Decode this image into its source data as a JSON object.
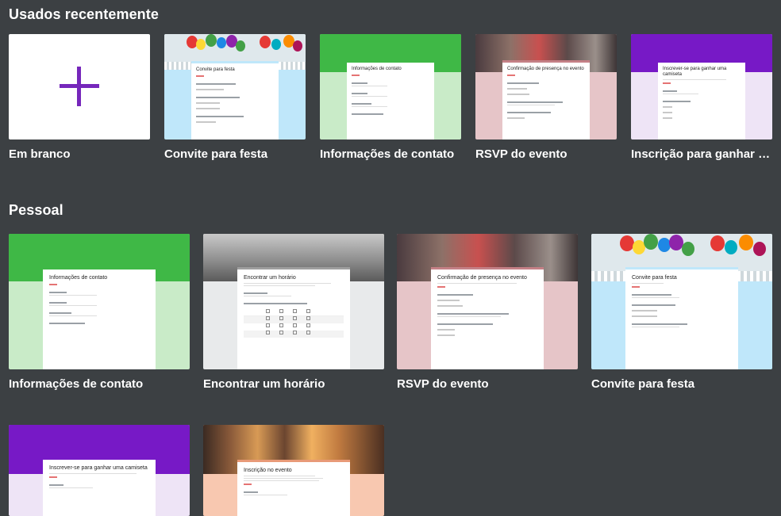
{
  "sections": {
    "recent_title": "Usados recentemente",
    "personal_title": "Pessoal"
  },
  "recent": [
    {
      "label": "Em branco"
    },
    {
      "label": "Convite para festa",
      "card_title": "Convite para festa"
    },
    {
      "label": "Informações de contato",
      "card_title": "Informações de contato"
    },
    {
      "label": "RSVP do evento",
      "card_title": "Confirmação de presença no evento"
    },
    {
      "label": "Inscrição para ganhar c...",
      "card_title": "Inscrever-se para ganhar uma camiseta"
    }
  ],
  "personal": [
    {
      "label": "Informações de contato",
      "card_title": "Informações de contato"
    },
    {
      "label": "Encontrar um horário",
      "card_title": "Encontrar um horário"
    },
    {
      "label": "RSVP do evento",
      "card_title": "Confirmação de presença no evento"
    },
    {
      "label": "Convite para festa",
      "card_title": "Convite para festa"
    },
    {
      "card_title": "Inscrever-se para ganhar uma camiseta"
    },
    {
      "card_title": "Inscrição no evento"
    }
  ],
  "colors": {
    "background": "#3c4043",
    "green": "#3fb846",
    "green_light": "#c9ebc8",
    "purple": "#7719c6",
    "purple_light": "#eee4f6",
    "pink": "#e6c5c8",
    "light_blue": "#bfe7fa",
    "peach": "#f8c8b0",
    "gray_light": "#e8eaeb",
    "plus": "#7627bb"
  }
}
